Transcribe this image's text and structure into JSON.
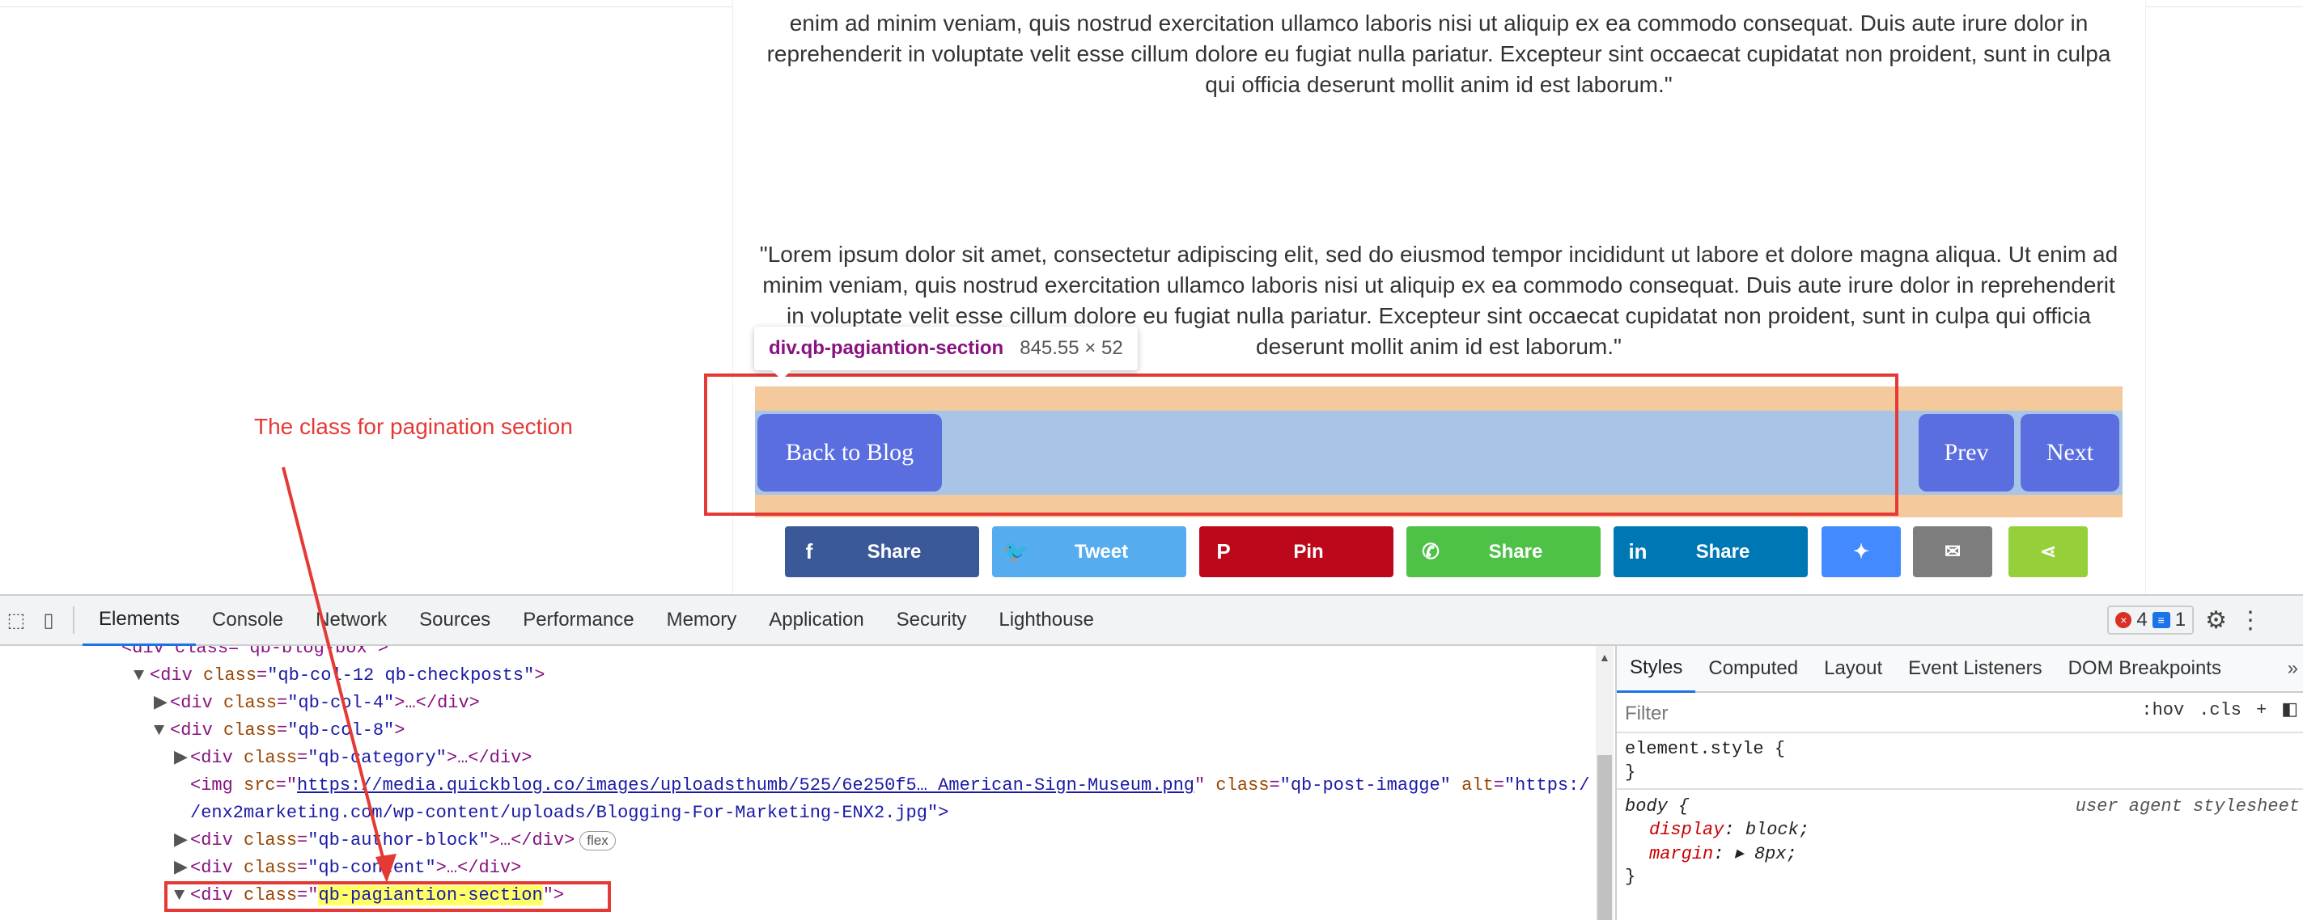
{
  "page": {
    "para1": "enim ad minim veniam, quis nostrud exercitation ullamco laboris nisi ut aliquip ex ea commodo consequat. Duis aute irure dolor in reprehenderit in voluptate velit esse cillum dolore eu fugiat nulla pariatur. Excepteur sint occaecat cupidatat non proident, sunt in culpa qui officia deserunt mollit anim id est laborum.\"",
    "para2": "\"Lorem ipsum dolor sit amet, consectetur adipiscing elit, sed do eiusmod tempor incididunt ut labore et dolore magna aliqua. Ut enim ad minim veniam, quis nostrud exercitation ullamco laboris nisi ut aliquip ex ea commodo consequat. Duis aute irure dolor in reprehenderit in voluptate velit esse cillum dolore eu fugiat nulla pariatur. Excepteur sint occaecat cupidatat non proident, sunt in culpa qui officia deserunt mollit anim id est laborum.\"",
    "tooltip": {
      "selector": "div.qb-pagiantion-section",
      "size": "845.55 × 52"
    },
    "pagination": {
      "back": "Back to Blog",
      "prev": "Prev",
      "next": "Next"
    },
    "annotation": "The class for pagination section",
    "share": [
      {
        "icon": "facebook-icon",
        "glyph": "f",
        "label": "Share",
        "color": "#3b5998"
      },
      {
        "icon": "twitter-icon",
        "glyph": "🐦",
        "label": "Tweet",
        "color": "#55acee"
      },
      {
        "icon": "pinterest-icon",
        "glyph": "P",
        "label": "Pin",
        "color": "#bd081c"
      },
      {
        "icon": "whatsapp-icon",
        "glyph": "✆",
        "label": "Share",
        "color": "#4dc247"
      },
      {
        "icon": "linkedin-icon",
        "glyph": "in",
        "label": "Share",
        "color": "#0077b5"
      },
      {
        "icon": "messenger-icon",
        "glyph": "✦",
        "color": "#448aff"
      },
      {
        "icon": "email-icon",
        "glyph": "✉",
        "color": "#7d7d7d"
      },
      {
        "icon": "share-icon",
        "glyph": "⋖",
        "color": "#95d03a"
      }
    ]
  },
  "devtools": {
    "tabs": [
      "Elements",
      "Console",
      "Network",
      "Sources",
      "Performance",
      "Memory",
      "Application",
      "Security",
      "Lighthouse"
    ],
    "active_tab": "Elements",
    "errors": "4",
    "messages": "1",
    "dom": {
      "l0": "<div class=\"qb-blog-box\">",
      "l1_tag": "<div ",
      "l1_attr": "class",
      "l1_val": "\"qb-col-12 qb-checkposts\"",
      "l2_val": "\"qb-col-4\"",
      "l2_tail": ">…</div>",
      "l3_val": "\"qb-col-8\"",
      "l4_val": "\"qb-category\"",
      "l4_tail": ">…</div>",
      "l5_src": "https://media.quickblog.co/images/uploadsthumb/525/6e250f5… American-Sign-Museum.png",
      "l5_class": "\"qb-post-imagge\"",
      "l5_alt": "\"https:/",
      "l6": "/enx2marketing.com/wp-content/uploads/Blogging-For-Marketing-ENX2.jpg\">",
      "l7_val": "\"qb-author-block\"",
      "l7_tail": ">…</div>",
      "l7_pill": "flex",
      "l8_val": "\"qb-content\"",
      "l8_tail": ">…</div>",
      "l9_val": "qb-pagiantion-section"
    },
    "styles": {
      "tabs": [
        "Styles",
        "Computed",
        "Layout",
        "Event Listeners",
        "DOM Breakpoints"
      ],
      "more": "»",
      "filter": "Filter",
      "hov": ":hov",
      "cls": ".cls",
      "plus": "+",
      "element_style": "element.style {",
      "close": "}",
      "body_sel": "body {",
      "ua_label": "user agent stylesheet",
      "prop1": "display",
      "val1": "block;",
      "prop2": "margin",
      "val2": "▸ 8px;"
    }
  }
}
